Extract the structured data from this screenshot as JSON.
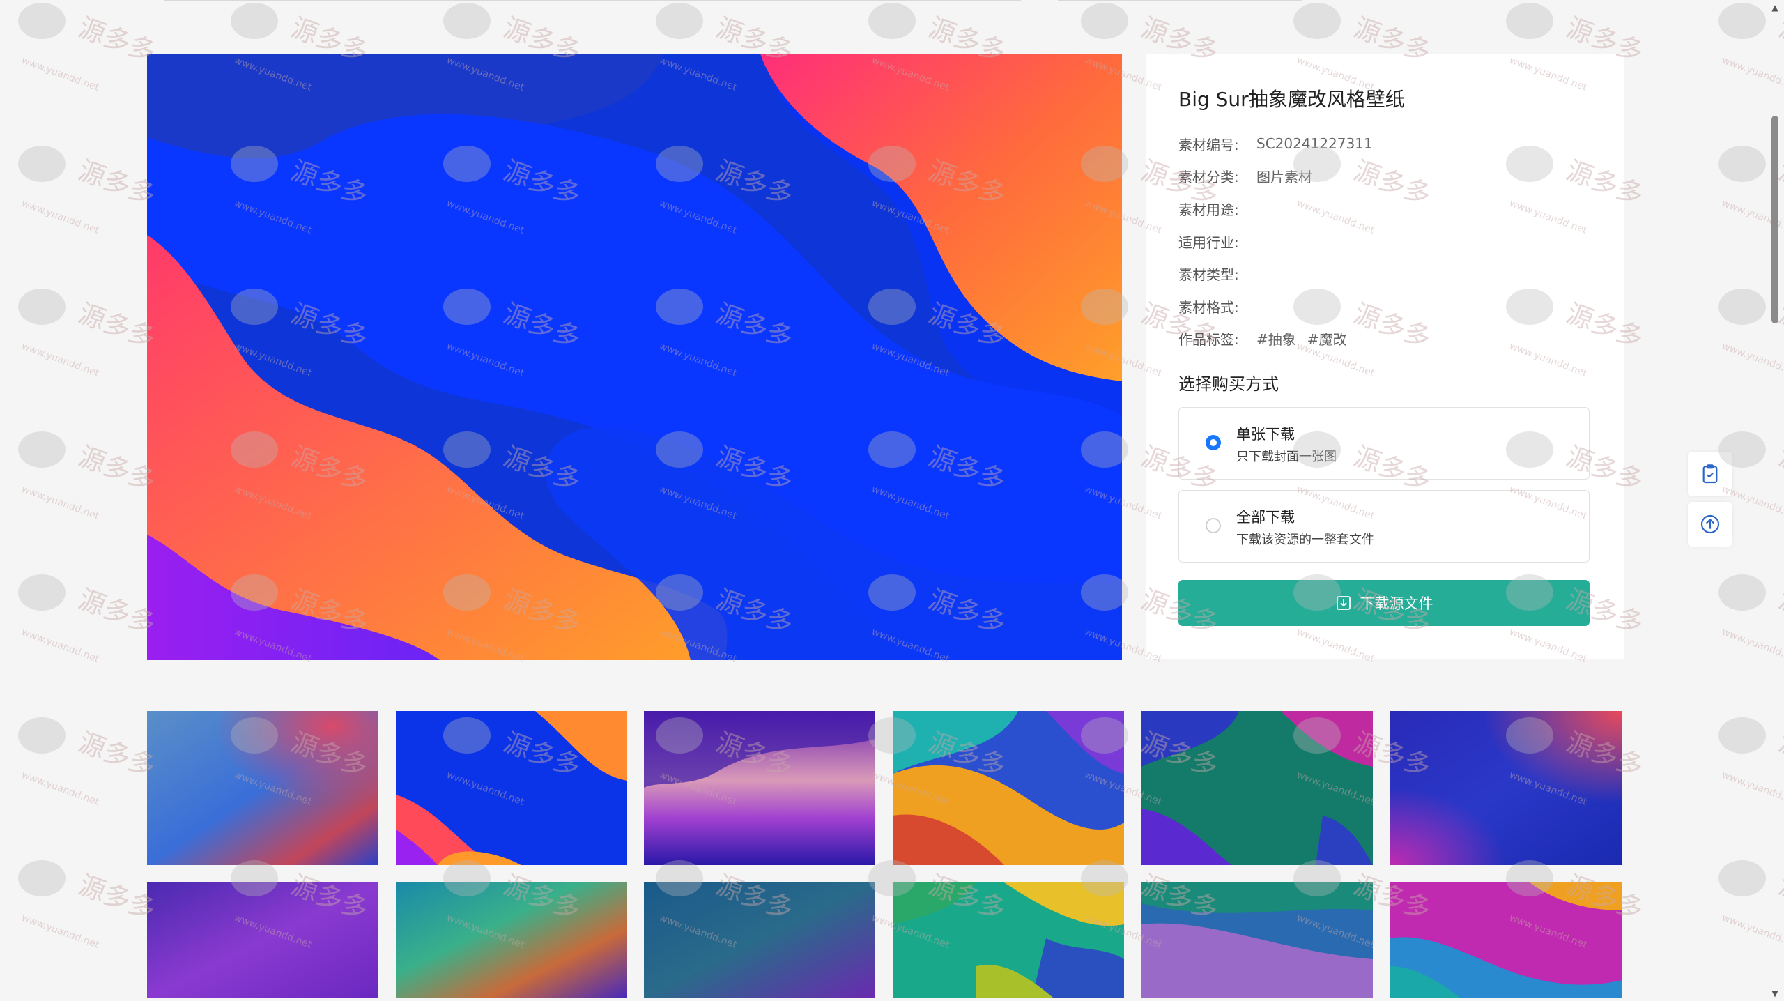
{
  "page": {
    "title": "Big Sur抽象魔改风格壁纸"
  },
  "meta": [
    {
      "label": "素材编号:",
      "value": "SC20241227311"
    },
    {
      "label": "素材分类:",
      "value": "图片素材"
    },
    {
      "label": "素材用途:",
      "value": ""
    },
    {
      "label": "适用行业:",
      "value": ""
    },
    {
      "label": "素材类型:",
      "value": ""
    },
    {
      "label": "素材格式:",
      "value": ""
    }
  ],
  "tags": {
    "label": "作品标签:",
    "items": [
      "#抽象",
      "#魔改"
    ]
  },
  "purchase": {
    "heading": "选择购买方式",
    "options": [
      {
        "title": "单张下载",
        "desc": "只下载封面一张图",
        "selected": true
      },
      {
        "title": "全部下载",
        "desc": "下载该资源的一整套文件",
        "selected": false
      }
    ],
    "download_label": "下载源文件"
  },
  "colors": {
    "accent": "#26ad98",
    "radio": "#1677ff"
  },
  "icons": {
    "download": "download-icon",
    "clipboard": "clipboard-check-icon",
    "back_to_top": "arrow-up-circle-icon"
  },
  "watermark": {
    "brand": "源多多",
    "url": "www.yuandd.net"
  }
}
